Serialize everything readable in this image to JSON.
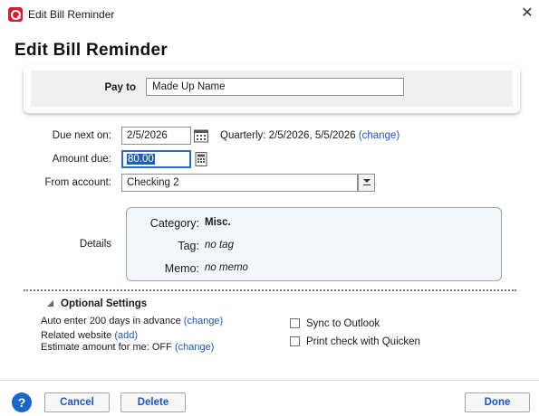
{
  "window": {
    "title": "Edit Bill Reminder",
    "close": "✕"
  },
  "heading": "Edit Bill Reminder",
  "pay_to": {
    "label": "Pay to",
    "value": "Made Up Name"
  },
  "due_next_on": {
    "label": "Due next on:",
    "value": "2/5/2026"
  },
  "quarterly": {
    "text": "Quarterly: 2/5/2026, 5/5/2026",
    "link": "(change)"
  },
  "amount_due": {
    "label": "Amount due:",
    "value": "80.00"
  },
  "from_account": {
    "label": "From account:",
    "value": "Checking 2"
  },
  "details": {
    "label": "Details",
    "category_label": "Category:",
    "category_value": "Misc.",
    "tag_label": "Tag:",
    "tag_value": "no tag",
    "memo_label": "Memo:",
    "memo_value": "no memo"
  },
  "optional": {
    "title": "Optional Settings",
    "auto_enter_text": "Auto enter 200 days in advance",
    "auto_enter_link": "(change)",
    "related_text": "Related website",
    "related_link": "(add)",
    "estimate_text": "Estimate amount for me: OFF",
    "estimate_link": "(change)",
    "sync_outlook": "Sync to Outlook",
    "print_check": "Print check with Quicken"
  },
  "footer": {
    "help": "?",
    "cancel": "Cancel",
    "delete": "Delete",
    "done": "Done"
  },
  "colors": {
    "accent": "#1f56b8",
    "brand": "#d61f2c",
    "selection": "#1e5cc4"
  }
}
